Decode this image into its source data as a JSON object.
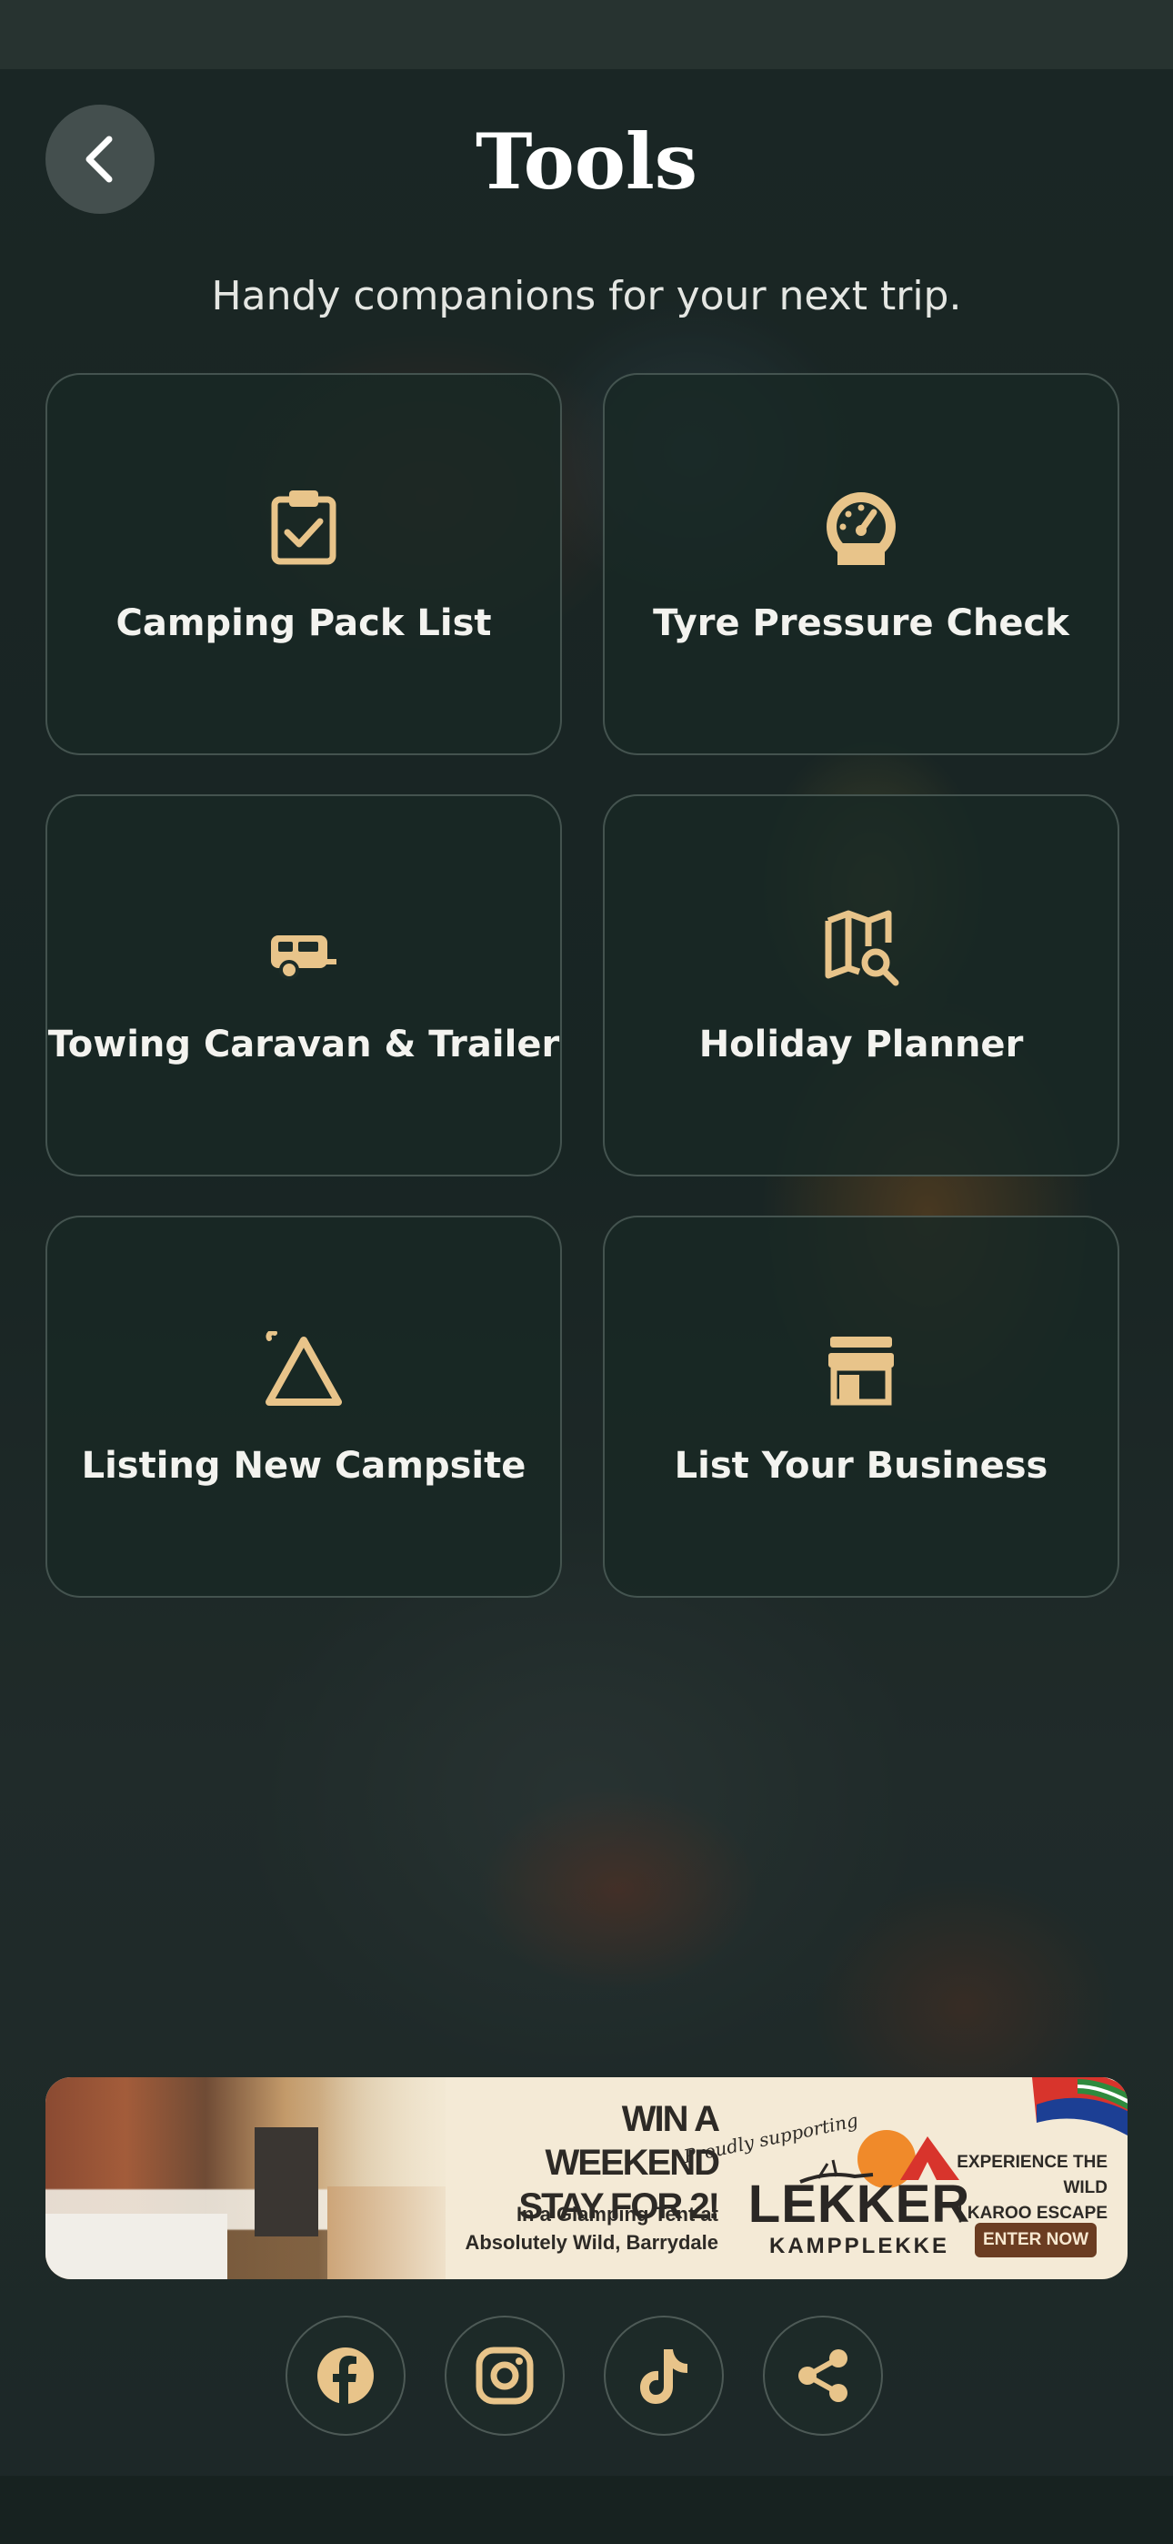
{
  "header": {
    "title": "Tools",
    "subtitle": "Handy companions for your next trip."
  },
  "colors": {
    "accent": "#e8c48a",
    "card_bg": "#182824",
    "text": "#ffffff"
  },
  "tools": [
    {
      "label": "Camping Pack List",
      "icon": "clipboard-check-icon"
    },
    {
      "label": "Tyre Pressure Check",
      "icon": "gauge-icon"
    },
    {
      "label": "Towing Caravan & Trailer",
      "icon": "caravan-icon"
    },
    {
      "label": "Holiday Planner",
      "icon": "map-search-icon"
    },
    {
      "label": "Listing New Campsite",
      "icon": "tent-icon"
    },
    {
      "label": "List Your Business",
      "icon": "storefront-icon"
    }
  ],
  "ad": {
    "headline_line1": "WIN A WEEKEND",
    "headline_line2": "STAY FOR 2!",
    "sub_line1": "In a Glamping Tent at",
    "sub_line2": "Absolutely Wild, Barrydale",
    "supporting": "Proudly supporting",
    "brand": "LEKKER",
    "brand_sub": "KAMPPLEKKE",
    "experience_line1": "EXPERIENCE THE WILD",
    "experience_line2": "| KAROO ESCAPE",
    "cta": "ENTER NOW"
  },
  "socials": [
    "facebook-icon",
    "instagram-icon",
    "tiktok-icon",
    "share-icon"
  ]
}
